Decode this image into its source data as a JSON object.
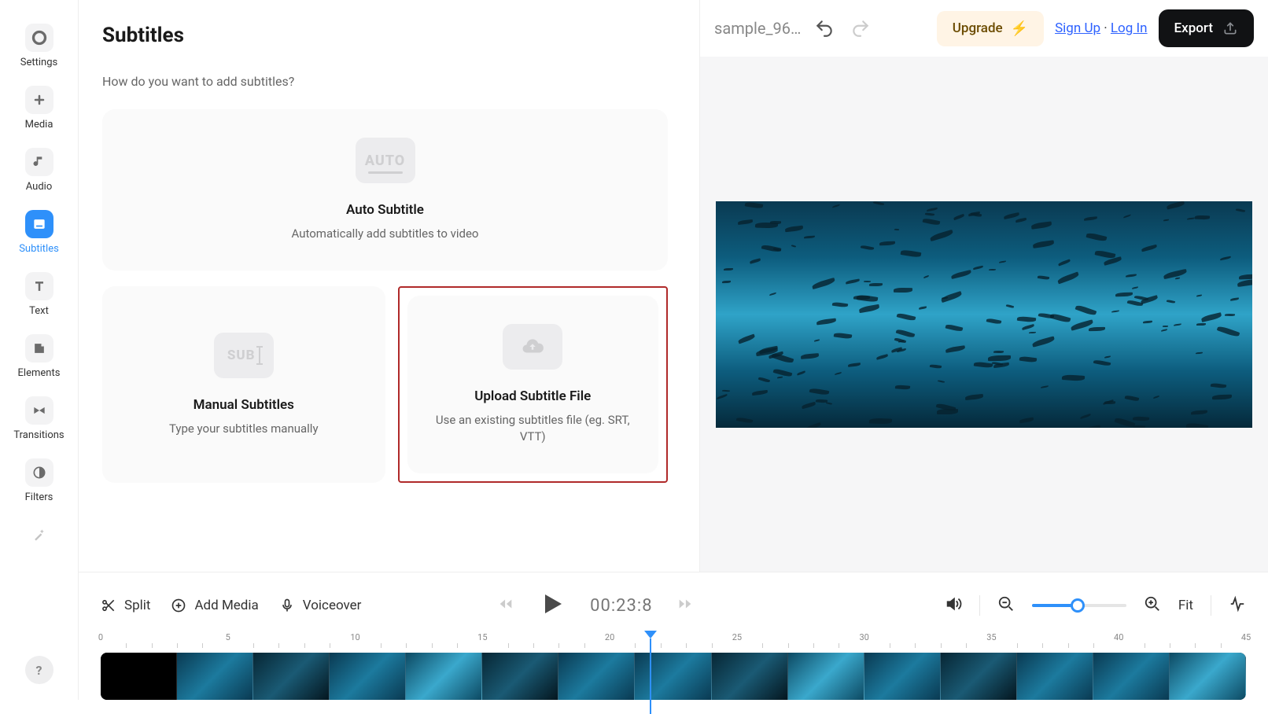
{
  "sidebar": {
    "items": [
      {
        "label": "Settings"
      },
      {
        "label": "Media"
      },
      {
        "label": "Audio"
      },
      {
        "label": "Subtitles"
      },
      {
        "label": "Text"
      },
      {
        "label": "Elements"
      },
      {
        "label": "Transitions"
      },
      {
        "label": "Filters"
      }
    ]
  },
  "panel": {
    "title": "Subtitles",
    "subtitle": "How do you want to add subtitles?",
    "auto": {
      "badge": "AUTO",
      "title": "Auto Subtitle",
      "desc": "Automatically add subtitles to video"
    },
    "manual": {
      "badge": "SUB",
      "title": "Manual Subtitles",
      "desc": "Type your subtitles manually"
    },
    "upload": {
      "title": "Upload Subtitle File",
      "desc": "Use an existing subtitles file (eg. SRT, VTT)"
    }
  },
  "topbar": {
    "project_name": "sample_96…",
    "upgrade": "Upgrade",
    "signup": "Sign Up",
    "login": "Log In",
    "separator": "·",
    "export": "Export"
  },
  "timeline": {
    "split": "Split",
    "add_media": "Add Media",
    "voiceover": "Voiceover",
    "timecode": "00:23:8",
    "fit": "Fit",
    "ruler_ticks": [
      "0",
      "5",
      "10",
      "15",
      "20",
      "25",
      "30",
      "35",
      "40",
      "45"
    ],
    "playhead_percent": 48
  }
}
